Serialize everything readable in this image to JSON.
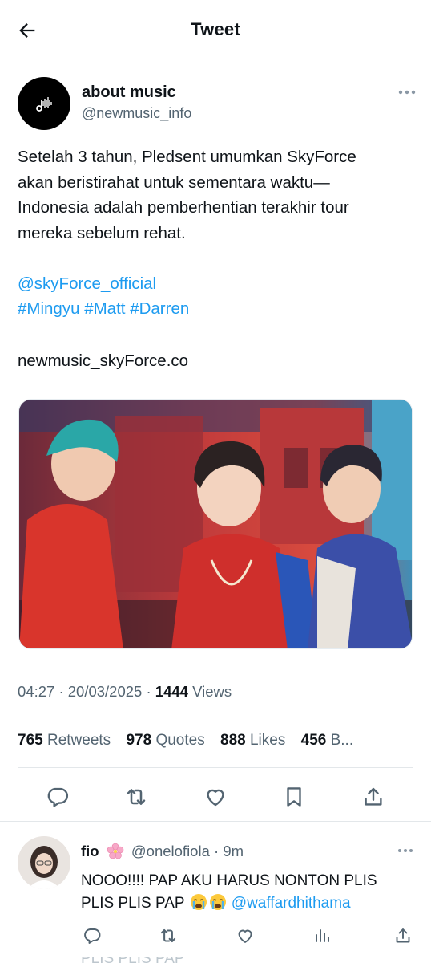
{
  "header": {
    "title": "Tweet",
    "back_icon": "back-arrow-icon"
  },
  "author": {
    "name": "about music",
    "handle": "@newmusic_info",
    "avatar_icon": "music-note-icon"
  },
  "tweet": {
    "lines": [
      "Setelah 3 tahun, Pledsent umumkan SkyForce",
      "akan beristirahat untuk sementara waktu—",
      "Indonesia adalah pemberhentian terakhir tour",
      "mereka sebelum rehat."
    ],
    "mention": "@skyForce_official",
    "hashtags": [
      "#Mingyu",
      "#Matt",
      "#Darren"
    ],
    "link_text": "newmusic_skyForce.co",
    "image_alt": "Three performers on stage"
  },
  "meta": {
    "time": "04:27",
    "date": "20/03/2025",
    "views_count": "1444",
    "views_label": "Views"
  },
  "stats": [
    {
      "count": "765",
      "label": "Retweets"
    },
    {
      "count": "978",
      "label": "Quotes"
    },
    {
      "count": "888",
      "label": "Likes"
    },
    {
      "count": "456",
      "label": "B..."
    }
  ],
  "reply": {
    "name": "fio",
    "handle": "@onelofiola",
    "time": "9m",
    "text_part1": "NOOO!!!! PAP AKU HARUS NONTON PLIS",
    "text_part2": "PLIS PLIS PAP",
    "mention": "@waffardhithama",
    "ghost_text": "PLIS PLIS PAP"
  },
  "colors": {
    "accent": "#1d9bf0",
    "text": "#0f1419",
    "muted": "#536471",
    "divider": "#e3e7ea"
  }
}
